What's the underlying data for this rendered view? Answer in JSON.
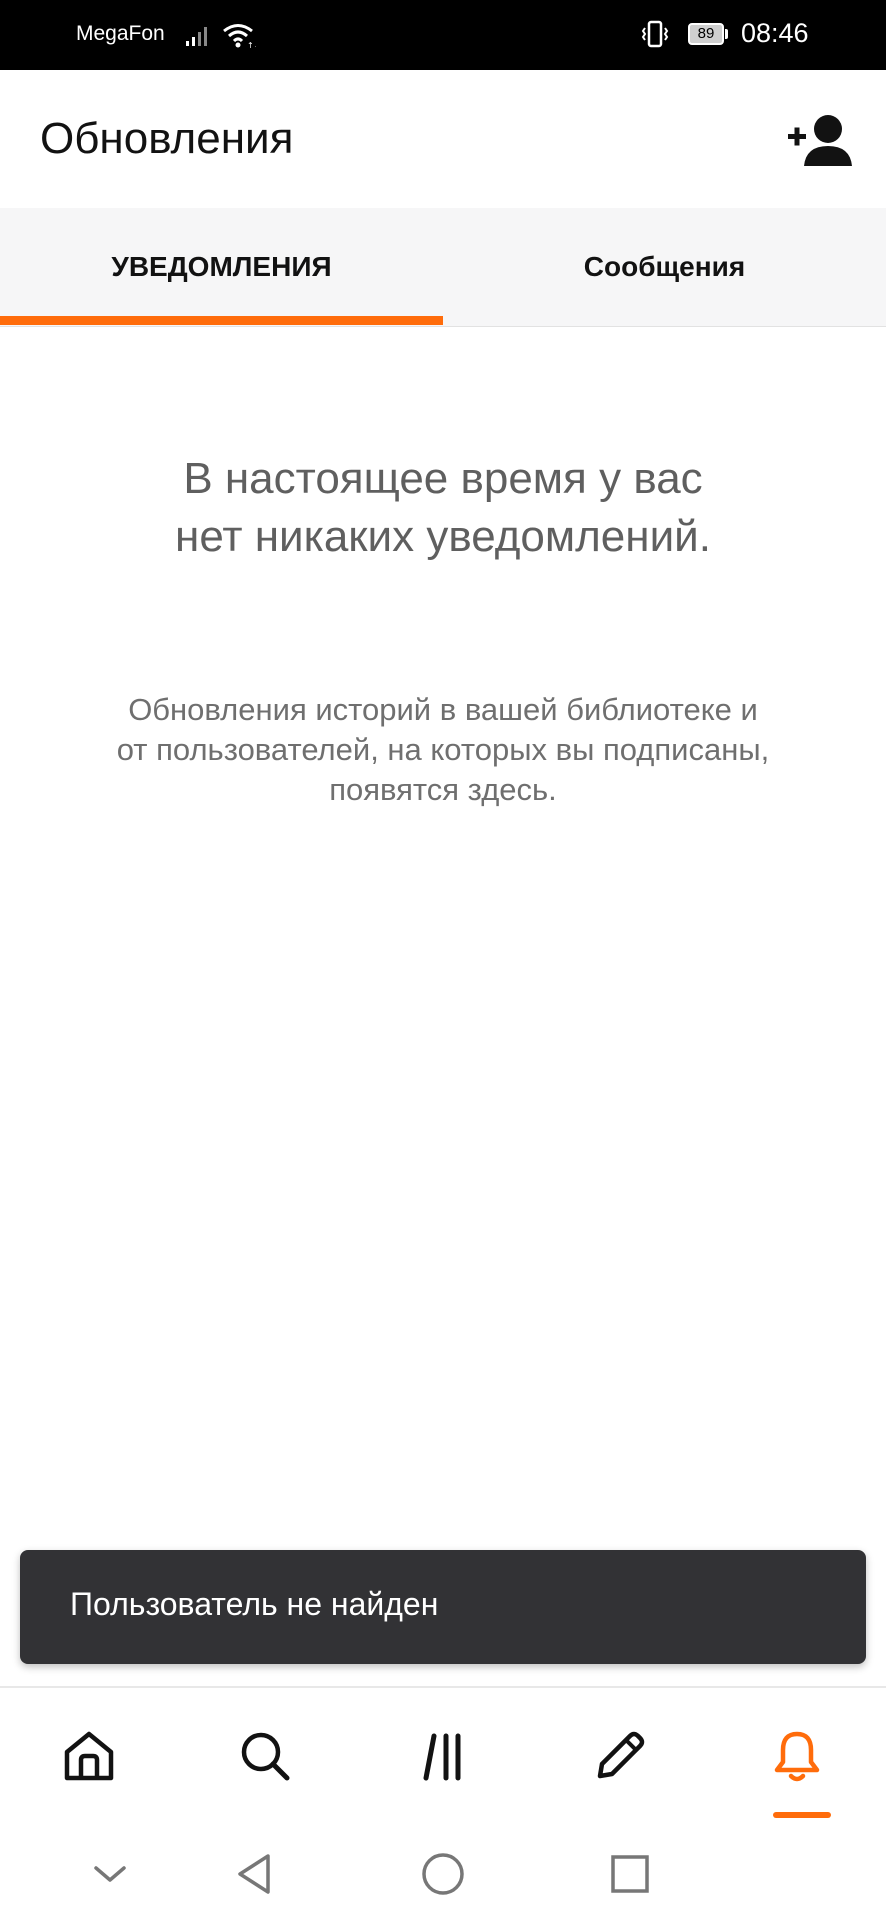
{
  "status_bar": {
    "carrier": "MegaFon",
    "battery_level": "89",
    "time": "08:46",
    "icons": [
      "signal-icon",
      "wifi-icon",
      "vibrate-icon",
      "battery-icon"
    ]
  },
  "header": {
    "title": "Обновления",
    "add_user_icon": "add-user-icon"
  },
  "tabs": [
    {
      "label": "УВЕДОМЛЕНИЯ",
      "active": true
    },
    {
      "label": "Сообщения",
      "active": false
    }
  ],
  "empty_state": {
    "title_lines": [
      "В настоящее время у вас",
      "нет никаких уведомлений."
    ],
    "description_lines": [
      "Обновления историй в вашей библиотеке и",
      "от пользователей, на которых вы подписаны,",
      "появятся здесь."
    ]
  },
  "toast": {
    "message": "Пользователь не найден"
  },
  "bottom_nav": {
    "items": [
      {
        "icon": "home-icon",
        "active": false
      },
      {
        "icon": "search-icon",
        "active": false
      },
      {
        "icon": "library-icon",
        "active": false
      },
      {
        "icon": "pencil-icon",
        "active": false
      },
      {
        "icon": "bell-icon",
        "active": true
      }
    ]
  },
  "colors": {
    "accent": "#ff6c0b",
    "status_bar_bg": "#000000",
    "tab_bar_bg": "#f6f6f7",
    "toast_bg": "#323235",
    "muted_text": "#6f6f6f"
  },
  "system_nav": {
    "icons": [
      "collapse-icon",
      "back-icon",
      "home-circle-icon",
      "recents-icon"
    ]
  }
}
